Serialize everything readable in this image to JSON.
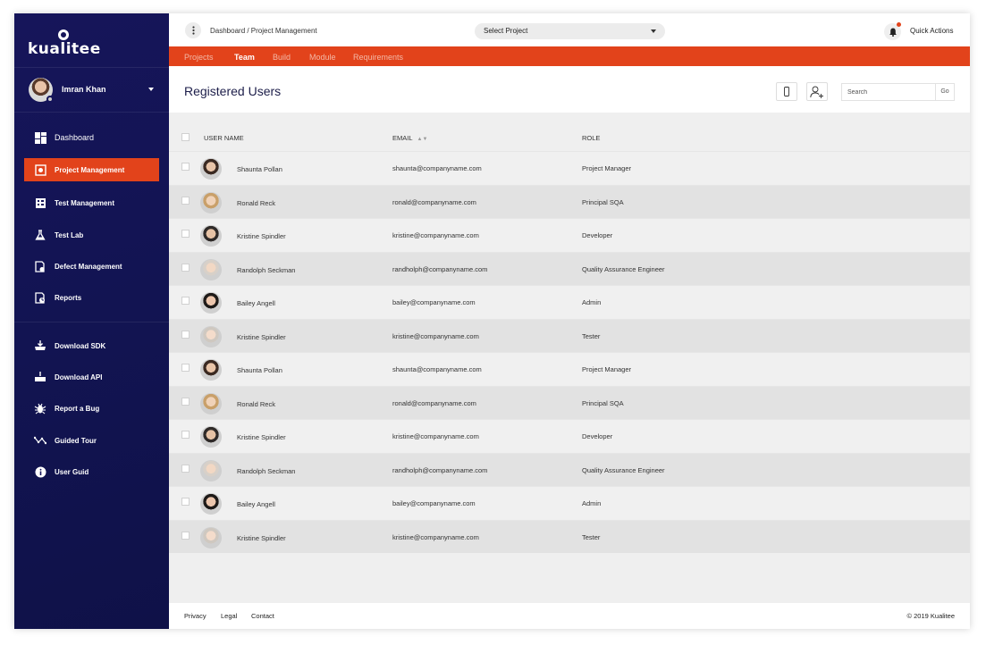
{
  "brand": {
    "logo_text": "kualitee"
  },
  "user": {
    "name": "Imran Khan"
  },
  "sidebar": {
    "primary": [
      {
        "label": "Dashboard",
        "icon": "dashboard-icon"
      },
      {
        "label": "Project Management",
        "icon": "project-management-icon",
        "active": true
      },
      {
        "label": "Test Management",
        "icon": "test-management-icon"
      },
      {
        "label": "Test Lab",
        "icon": "flask-icon"
      },
      {
        "label": "Defect Management",
        "icon": "defect-icon"
      },
      {
        "label": "Reports",
        "icon": "reports-icon"
      }
    ],
    "secondary": [
      {
        "label": "Download SDK",
        "icon": "download-sdk-icon"
      },
      {
        "label": "Download API",
        "icon": "download-api-icon"
      },
      {
        "label": "Report a Bug",
        "icon": "bug-icon"
      },
      {
        "label": "Guided Tour",
        "icon": "tour-icon"
      },
      {
        "label": "User Guid",
        "icon": "info-icon"
      }
    ]
  },
  "topbar": {
    "breadcrumb": "Dashboard / Project Management",
    "select_project": "Select Project",
    "quick_actions": "Quick Actions"
  },
  "tabs": [
    {
      "label": "Projects"
    },
    {
      "label": "Team",
      "active": true
    },
    {
      "label": "Build"
    },
    {
      "label": "Module"
    },
    {
      "label": "Requirements"
    }
  ],
  "page": {
    "title": "Registered Users",
    "search_placeholder": "Search",
    "go_label": "Go"
  },
  "table": {
    "headers": {
      "name": "USER NAME",
      "email": "EMAIL",
      "role": "ROLE"
    },
    "rows": [
      {
        "name": "Shaunta Pollan",
        "email": "shaunta@companyname.com",
        "role": "Project Manager"
      },
      {
        "name": "Ronald Reck",
        "email": "ronald@companyname.com",
        "role": "Principal SQA"
      },
      {
        "name": "Kristine Spindler",
        "email": "kristine@companyname.com",
        "role": "Developer"
      },
      {
        "name": "Randolph Seckman",
        "email": "randholph@companyname.com",
        "role": "Quality Assurance Engineer"
      },
      {
        "name": "Bailey Angell",
        "email": "bailey@companyname.com",
        "role": "Admin"
      },
      {
        "name": "Kristine Spindler",
        "email": "kristine@companyname.com",
        "role": "Tester"
      },
      {
        "name": "Shaunta Pollan",
        "email": "shaunta@companyname.com",
        "role": "Project Manager"
      },
      {
        "name": "Ronald Reck",
        "email": "ronald@companyname.com",
        "role": "Principal SQA"
      },
      {
        "name": "Kristine Spindler",
        "email": "kristine@companyname.com",
        "role": "Developer"
      },
      {
        "name": "Randolph Seckman",
        "email": "randholph@companyname.com",
        "role": "Quality Assurance Engineer"
      },
      {
        "name": "Bailey Angell",
        "email": "bailey@companyname.com",
        "role": "Admin"
      },
      {
        "name": "Kristine Spindler",
        "email": "kristine@companyname.com",
        "role": "Tester"
      }
    ]
  },
  "footer": {
    "links": [
      "Privacy",
      "Legal",
      "Contact"
    ],
    "copyright": "© 2019  Kualitee"
  },
  "colors": {
    "accent": "#e2431b",
    "sidebar": "#14145a",
    "title": "#1d1e4a"
  }
}
